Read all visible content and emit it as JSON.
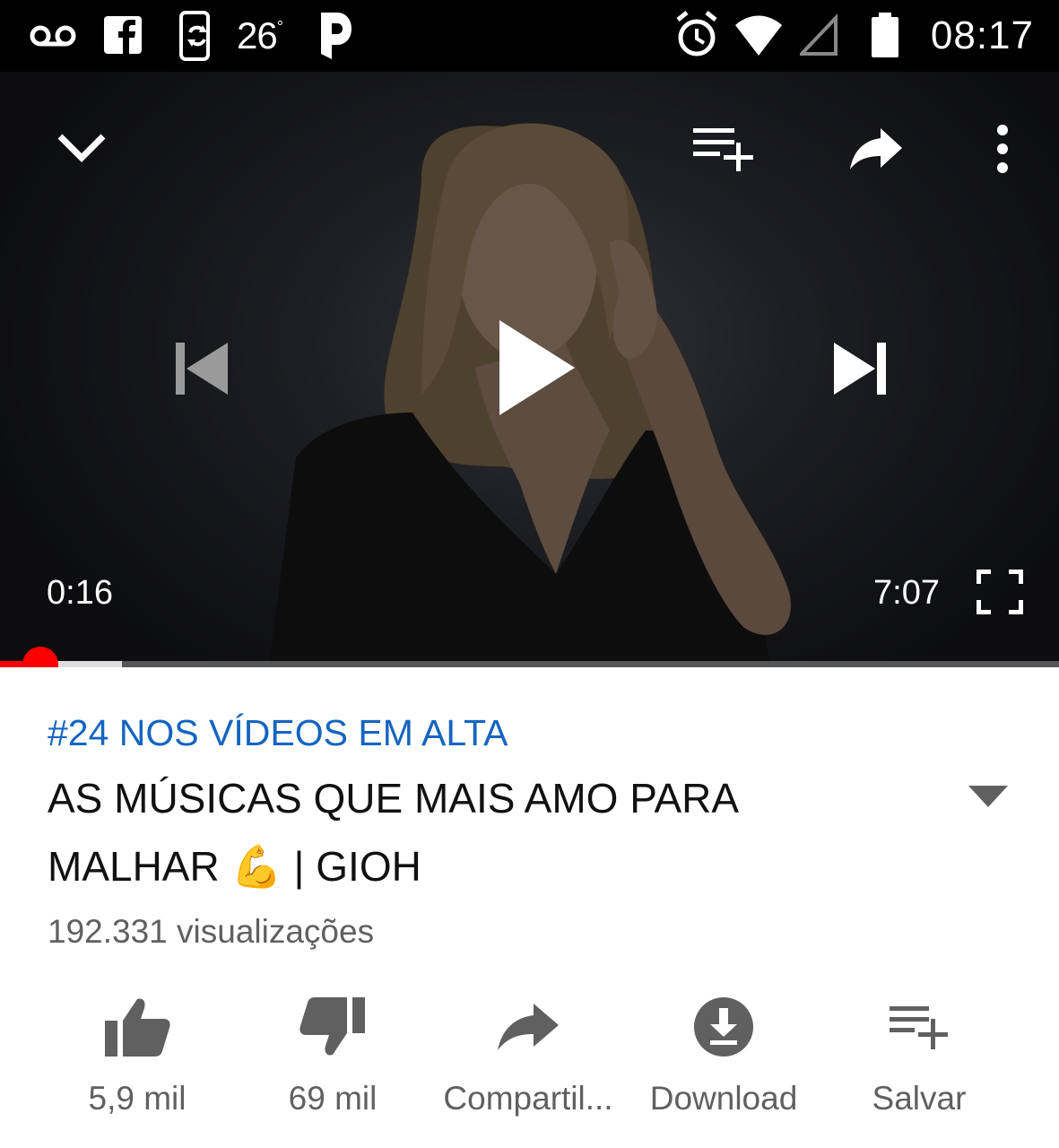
{
  "status_bar": {
    "icons": [
      "voicemail-icon",
      "facebook-icon",
      "phone-sync-icon",
      "pocket-casts-icon",
      "alarm-icon",
      "wifi-icon",
      "cell-signal-icon",
      "battery-icon"
    ],
    "temperature": "26",
    "temperature_unit": "°",
    "time": "08:17"
  },
  "player": {
    "icons": [
      "collapse-chevron-icon",
      "add-to-queue-icon",
      "share-icon",
      "more-vert-icon",
      "previous-icon",
      "play-icon",
      "next-icon",
      "fullscreen-icon"
    ],
    "current_time": "0:16",
    "duration": "7:07",
    "progress_fraction": 0.0375,
    "buffered_fraction": 0.115,
    "accent_color": "#ff0000"
  },
  "info": {
    "trending_label": "#24 NOS VÍDEOS EM ALTA",
    "title_line1": "AS MÚSICAS QUE MAIS AMO PARA",
    "title_line2": "MALHAR 💪 | GIOH",
    "views": "192.331 visualizações",
    "trending_color": "#1565c0"
  },
  "actions": [
    {
      "icon": "thumb-up-icon",
      "label": "5,9 mil"
    },
    {
      "icon": "thumb-down-icon",
      "label": "69 mil"
    },
    {
      "icon": "share-icon",
      "label": "Compartil..."
    },
    {
      "icon": "download-icon",
      "label": "Download"
    },
    {
      "icon": "playlist-add-icon",
      "label": "Salvar"
    }
  ]
}
